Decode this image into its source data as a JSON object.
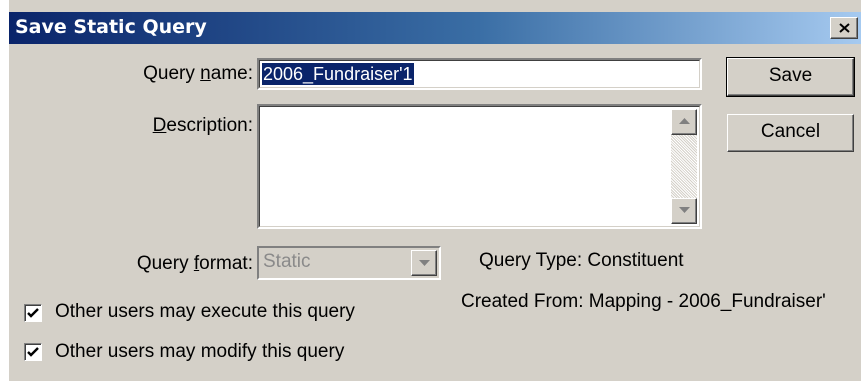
{
  "window": {
    "title": "Save Static Query"
  },
  "form": {
    "query_name_label_pre": "Query ",
    "query_name_label_u": "n",
    "query_name_label_post": "ame:",
    "query_name_value": "2006_Fundraiser'1",
    "description_label_u": "D",
    "description_label_post": "escription:",
    "description_value": "",
    "query_format_label_pre": "Query ",
    "query_format_label_u": "f",
    "query_format_label_post": "ormat:",
    "query_format_value": "Static"
  },
  "info": {
    "query_type": "Query Type: Constituent",
    "created_from": "Created From: Mapping - 2006_Fundraiser'"
  },
  "options": {
    "execute_label": "Other users may execute this query",
    "execute_checked": true,
    "modify_label": "Other users may modify this query",
    "modify_checked": true
  },
  "buttons": {
    "save": "Save",
    "cancel": "Cancel"
  },
  "icons": {
    "close": "close-icon",
    "scroll_up": "arrow-up-icon",
    "scroll_down": "arrow-down-icon",
    "dropdown": "chevron-down-icon",
    "check": "checkmark-icon"
  }
}
